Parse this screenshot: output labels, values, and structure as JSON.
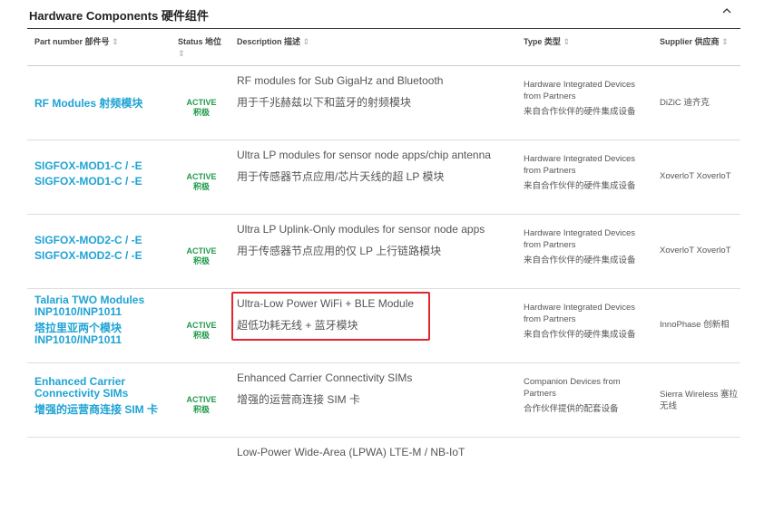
{
  "section": {
    "title": "Hardware Components 硬件组件"
  },
  "columns": {
    "part": "Part number 部件号",
    "status": "Status 地位",
    "description": "Description 描述",
    "type": "Type 类型",
    "supplier": "Supplier 供应商",
    "sort_glyph": "⇕"
  },
  "rows": [
    {
      "part": "RF Modules 射频模块",
      "status_en": "ACTIVE",
      "status_zh": "积极",
      "desc_en": "RF modules for Sub GigaHz and Bluetooth",
      "desc_zh": "用于千兆赫兹以下和蓝牙的射频模块",
      "type_en": "Hardware Integrated Devices from Partners",
      "type_zh": "来自合作伙伴的硬件集成设备",
      "supplier": "DiZiC 迪齐克"
    },
    {
      "part": "SIGFOX-MOD1-C / -E",
      "part2": "SIGFOX-MOD1-C / -E",
      "status_en": "ACTIVE",
      "status_zh": "积极",
      "desc_en": "Ultra LP modules for sensor node apps/chip antenna",
      "desc_zh": "用于传感器节点应用/芯片天线的超 LP 模块",
      "type_en": "Hardware Integrated Devices from Partners",
      "type_zh": "来自合作伙伴的硬件集成设备",
      "supplier": "XoverloT XoverloT"
    },
    {
      "part": "SIGFOX-MOD2-C / -E",
      "part2": "SIGFOX-MOD2-C / -E",
      "status_en": "ACTIVE",
      "status_zh": "积极",
      "desc_en": "Ultra LP Uplink-Only modules for sensor node apps",
      "desc_zh": "用于传感器节点应用的仅 LP 上行链路模块",
      "type_en": "Hardware Integrated Devices from Partners",
      "type_zh": "来自合作伙伴的硬件集成设备",
      "supplier": "XoverloT XoverloT"
    },
    {
      "part": "Talaria TWO Modules INP1010/INP1011",
      "part2": "塔拉里亚两个模块 INP1010/INP1011",
      "status_en": "ACTIVE",
      "status_zh": "积极",
      "desc_en": "Ultra-Low Power WiFi + BLE Module",
      "desc_zh": "超低功耗无线 + 蓝牙模块",
      "type_en": "Hardware Integrated Devices from Partners",
      "type_zh": "来自合作伙伴的硬件集成设备",
      "supplier": "InnoPhase 创新相"
    },
    {
      "part": "Enhanced Carrier Connectivity SIMs",
      "part2": "增强的运营商连接 SIM 卡",
      "status_en": "ACTIVE",
      "status_zh": "积极",
      "desc_en": "Enhanced Carrier Connectivity SIMs",
      "desc_zh": "增强的运营商连接 SIM 卡",
      "type_en": "Companion Devices from Partners",
      "type_zh": "合作伙伴提供的配套设备",
      "supplier": "Sierra Wireless 塞拉无线"
    },
    {
      "desc_en": "Low-Power Wide-Area (LPWA) LTE-M / NB-IoT"
    }
  ],
  "highlight_color": "#e0272c",
  "accent": "#1fa3d4",
  "status_color": "#1f9a4a"
}
